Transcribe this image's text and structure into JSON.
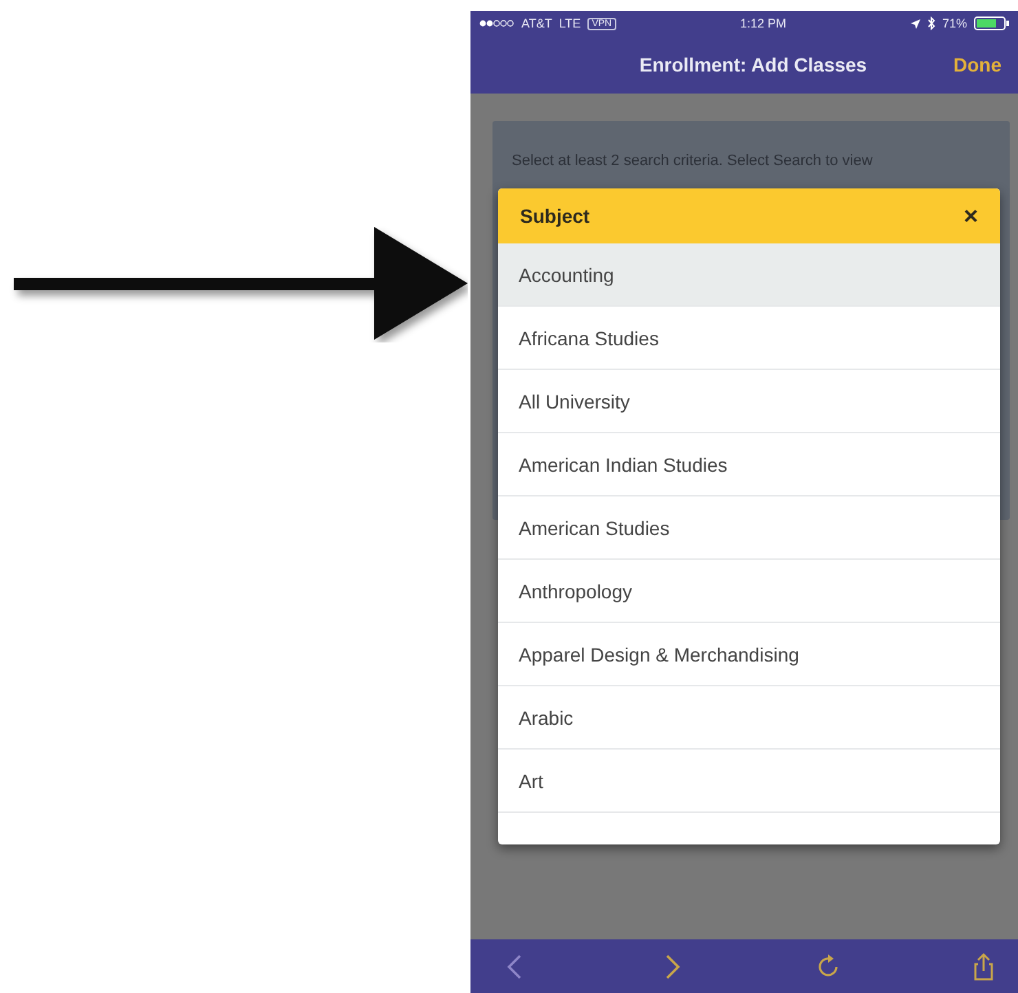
{
  "status_bar": {
    "carrier": "AT&T",
    "network": "LTE",
    "vpn": "VPN",
    "time": "1:12 PM",
    "battery": "71%"
  },
  "nav_bar": {
    "title": "Enrollment: Add Classes",
    "done": "Done"
  },
  "instructions": "Select at least 2 search criteria. Select Search to view",
  "subject_picker": {
    "title": "Subject",
    "close": "×",
    "items": [
      {
        "label": "Accounting",
        "selected": true
      },
      {
        "label": "Africana Studies",
        "selected": false
      },
      {
        "label": "All University",
        "selected": false
      },
      {
        "label": "American Indian Studies",
        "selected": false
      },
      {
        "label": "American Studies",
        "selected": false
      },
      {
        "label": "Anthropology",
        "selected": false
      },
      {
        "label": "Apparel Design & Merchandising",
        "selected": false
      },
      {
        "label": "Arabic",
        "selected": false
      },
      {
        "label": "Art",
        "selected": false
      }
    ]
  }
}
